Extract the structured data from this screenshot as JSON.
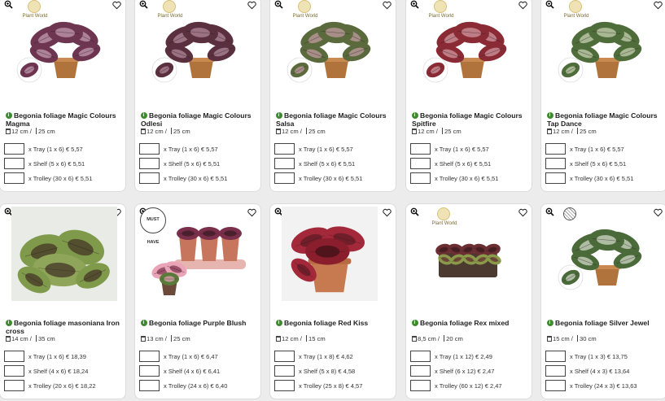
{
  "brand_badge": "Plant World",
  "must_have_badge": "MUST HAVE",
  "icons": {
    "zoom": "zoom-icon",
    "favorite": "heart-icon",
    "info": "info-icon",
    "pot": "pot-size-icon",
    "height": "height-icon"
  },
  "colors": {
    "info_green": "#3f8a2e",
    "card_border": "#dcdcdc"
  },
  "products": [
    {
      "name": "Begonia foliage Magic Colours Magma",
      "pot": "12 cm",
      "height": "25 cm",
      "options": [
        "x Tray (1 x 6) € 5,57",
        "x Shelf (5 x 6) € 5,51",
        "x Trolley (30 x 6) € 5,51"
      ]
    },
    {
      "name": "Begonia foliage Magic Colours Odlesi",
      "pot": "12 cm",
      "height": "25 cm",
      "options": [
        "x Tray (1 x 6) € 5,57",
        "x Shelf (5 x 6) € 5,51",
        "x Trolley (30 x 6) € 5,51"
      ]
    },
    {
      "name": "Begonia foliage Magic Colours Salsa",
      "pot": "12 cm",
      "height": "25 cm",
      "options": [
        "x Tray (1 x 6) € 5,57",
        "x Shelf (5 x 6) € 5,51",
        "x Trolley (30 x 6) € 5,51"
      ]
    },
    {
      "name": "Begonia foliage Magic Colours Spitfire",
      "pot": "12 cm",
      "height": "25 cm",
      "options": [
        "x Tray (1 x 6) € 5,57",
        "x Shelf (5 x 6) € 5,51",
        "x Trolley (30 x 6) € 5,51"
      ]
    },
    {
      "name": "Begonia foliage Magic Colours Tap Dance",
      "pot": "12 cm",
      "height": "25 cm",
      "options": [
        "x Tray (1 x 6) € 5,57",
        "x Shelf (5 x 6) € 5,51",
        "x Trolley (30 x 6) € 5,51"
      ]
    },
    {
      "name": "Begonia foliage masoniana Iron cross",
      "pot": "14 cm",
      "height": "35 cm",
      "options": [
        "x Tray (1 x 6) € 18,39",
        "x Shelf (4 x 6) € 18,24",
        "x Trolley (20 x 6) € 18,22"
      ]
    },
    {
      "name": "Begonia foliage Purple Blush",
      "pot": "13 cm",
      "height": "25 cm",
      "options": [
        "x Tray (1 x 6) € 6,47",
        "x Shelf (4 x 6) € 6,41",
        "x Trolley (24 x 6) € 6,40"
      ]
    },
    {
      "name": "Begonia foliage Red Kiss",
      "pot": "12 cm",
      "height": "15 cm",
      "options": [
        "x Tray (1 x 8) € 4,62",
        "x Shelf (5 x 8) € 4,58",
        "x Trolley (25 x 8) € 4,57"
      ]
    },
    {
      "name": "Begonia foliage Rex mixed",
      "pot": "8,5 cm",
      "height": "20 cm",
      "options": [
        "x Tray (1 x 12) € 2,49",
        "x Shelf (6 x 12) € 2,47",
        "x Trolley (60 x 12) € 2,47"
      ]
    },
    {
      "name": "Begonia foliage Silver Jewel",
      "pot": "15 cm",
      "height": "30 cm",
      "options": [
        "x Tray (1 x 3) € 13,75",
        "x Shelf (4 x 3) € 13,64",
        "x Trolley (24 x 3) € 13,63"
      ]
    }
  ]
}
